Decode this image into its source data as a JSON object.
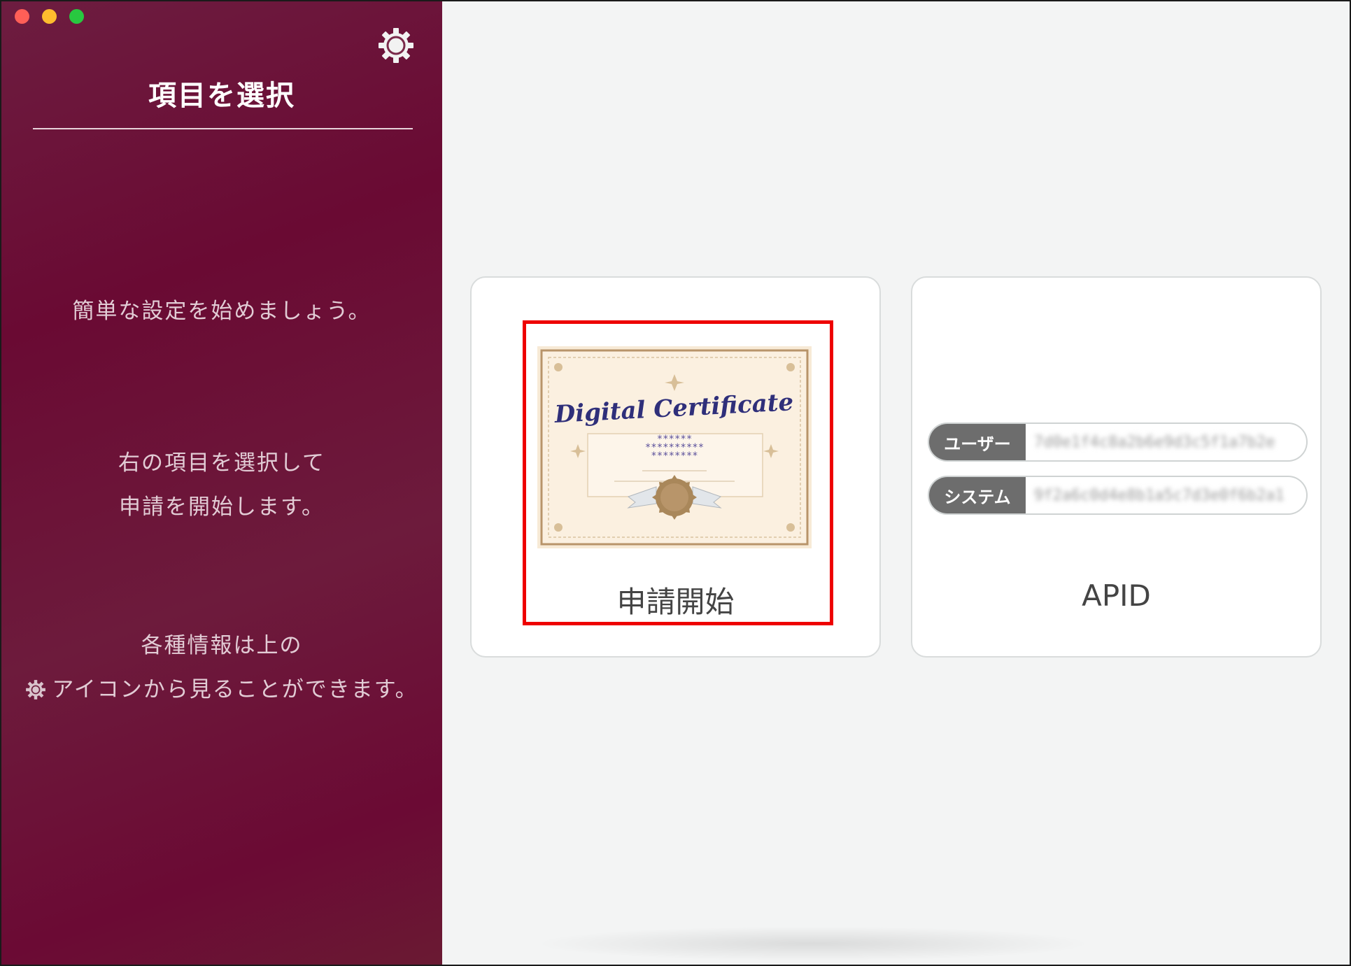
{
  "window": {
    "traffic_lights": [
      "close",
      "minimize",
      "zoom"
    ]
  },
  "sidebar": {
    "settings_icon": "gear-icon",
    "title": "項目を選択",
    "intro": "簡単な設定を始めましょう。",
    "instruction": [
      "右の項目を選択して",
      "申請を開始します。"
    ],
    "info": [
      "各種情報は上の",
      "アイコンから見ることができます。"
    ],
    "info_icon": "gear-icon"
  },
  "cards": {
    "apply": {
      "label": "申請開始",
      "image_title": "Digital Certificate",
      "image_stars": [
        "******",
        "**********",
        "********"
      ],
      "highlighted": true
    },
    "apid": {
      "label": "APID",
      "rows": [
        {
          "tag": "ユーザー",
          "value": "7d0e1f4c8a2b6e9d3c5f1a7b2e"
        },
        {
          "tag": "システム",
          "value": "9f2a6c0d4e8b1a5c7d3e0f6b2a1"
        }
      ]
    }
  },
  "colors": {
    "sidebar_bg": "#6a0a33",
    "highlight": "#ee0000",
    "tag_bg": "#6d6d6d"
  }
}
